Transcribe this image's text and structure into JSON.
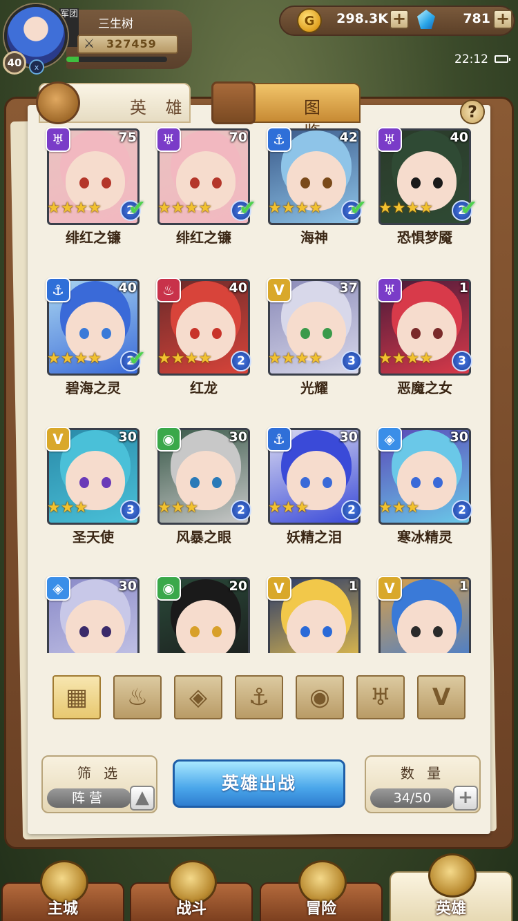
{
  "player": {
    "name": "三生树",
    "level": "40",
    "guild_badge": "军团",
    "vip_badge": "x",
    "power": "327459",
    "exp_progress": 0.12
  },
  "currency": {
    "gold": "298.3K",
    "diamonds": "781"
  },
  "status_bar": {
    "time": "22:12"
  },
  "tabs": {
    "heroes": "英 雄",
    "codex": "图 鉴"
  },
  "help_label": "?",
  "factions": {
    "dark": {
      "color": "#7a3cc8",
      "glyph": "♅"
    },
    "sea": {
      "color": "#2f6fd8",
      "glyph": "⚓"
    },
    "fire": {
      "color": "#c8324a",
      "glyph": "♨"
    },
    "light": {
      "color": "#d9a82a",
      "glyph": "V"
    },
    "beast": {
      "color": "#3aa84a",
      "glyph": "◉"
    },
    "ice": {
      "color": "#3a8ee8",
      "glyph": "◈"
    }
  },
  "heroes": [
    {
      "name": "绯红之镰",
      "level": "75",
      "faction": "dark",
      "stars": 4,
      "rank": "2",
      "deployed": true,
      "hair": "#f2b8c0",
      "eye": "#b4362a",
      "bg": "#e9c2c0"
    },
    {
      "name": "绯红之镰",
      "level": "70",
      "faction": "dark",
      "stars": 4,
      "rank": "2",
      "deployed": true,
      "hair": "#f2b8c0",
      "eye": "#b4362a",
      "bg": "#e9c2c0"
    },
    {
      "name": "海神",
      "level": "42",
      "faction": "sea",
      "stars": 4,
      "rank": "2",
      "deployed": true,
      "hair": "#8ec4e8",
      "eye": "#7a4a1a",
      "bg": "#3b5a8a"
    },
    {
      "name": "恐惧梦魇",
      "level": "40",
      "faction": "dark",
      "stars": 4,
      "rank": "2",
      "deployed": true,
      "hair": "#2f4a34",
      "eye": "#1a1a1a",
      "bg": "#2a3a2a"
    },
    {
      "name": "碧海之灵",
      "level": "40",
      "faction": "sea",
      "stars": 4,
      "rank": "2",
      "deployed": true,
      "hair": "#3a6ad8",
      "eye": "#3a7ad8",
      "bg": "#a8d4f0"
    },
    {
      "name": "红龙",
      "level": "40",
      "faction": "fire",
      "stars": 4,
      "rank": "2",
      "deployed": false,
      "hair": "#d8443a",
      "eye": "#c8342a",
      "bg": "#6a2a2a"
    },
    {
      "name": "光耀",
      "level": "37",
      "faction": "light",
      "stars": 4,
      "rank": "3",
      "deployed": false,
      "hair": "#d8d8ea",
      "eye": "#3a9a4a",
      "bg": "#8a8ab8"
    },
    {
      "name": "恶魔之女",
      "level": "1",
      "faction": "dark",
      "stars": 4,
      "rank": "3",
      "deployed": false,
      "hair": "#d83a4a",
      "eye": "#7a2a2a",
      "bg": "#4a1a3a"
    },
    {
      "name": "圣天使",
      "level": "30",
      "faction": "light",
      "stars": 3,
      "rank": "3",
      "deployed": false,
      "hair": "#4ac0d8",
      "eye": "#6a3ab8",
      "bg": "#2a8aa8"
    },
    {
      "name": "风暴之眼",
      "level": "30",
      "faction": "beast",
      "stars": 3,
      "rank": "2",
      "deployed": false,
      "hair": "#c8c8c8",
      "eye": "#2a7ab8",
      "bg": "#3a5a4a"
    },
    {
      "name": "妖精之泪",
      "level": "30",
      "faction": "sea",
      "stars": 3,
      "rank": "2",
      "deployed": false,
      "hair": "#3a4ad8",
      "eye": "#3a6ad8",
      "bg": "#d8d8f0"
    },
    {
      "name": "寒冰精灵",
      "level": "30",
      "faction": "ice",
      "stars": 3,
      "rank": "2",
      "deployed": false,
      "hair": "#6ac8e8",
      "eye": "#3a6ad8",
      "bg": "#5a4ab8"
    },
    {
      "name": "",
      "level": "30",
      "faction": "ice",
      "stars": 0,
      "rank": "",
      "deployed": false,
      "hair": "#c8c8e8",
      "eye": "#3a2a6a",
      "bg": "#8a8ac8"
    },
    {
      "name": "",
      "level": "20",
      "faction": "beast",
      "stars": 0,
      "rank": "",
      "deployed": false,
      "hair": "#1a1a1a",
      "eye": "#d8a02a",
      "bg": "#2a4a3a"
    },
    {
      "name": "",
      "level": "1",
      "faction": "light",
      "stars": 0,
      "rank": "",
      "deployed": false,
      "hair": "#f2c84a",
      "eye": "#2a6ad8",
      "bg": "#2a3a6a"
    },
    {
      "name": "",
      "level": "1",
      "faction": "light",
      "stars": 0,
      "rank": "",
      "deployed": false,
      "hair": "#3a7ad8",
      "eye": "#2a2a2a",
      "bg": "#d8a04a"
    }
  ],
  "faction_filters": [
    {
      "id": "all",
      "glyph": "▦",
      "active": true
    },
    {
      "id": "fire",
      "glyph": "♨",
      "active": false
    },
    {
      "id": "ice",
      "glyph": "◈",
      "active": false
    },
    {
      "id": "sea",
      "glyph": "⚓",
      "active": false
    },
    {
      "id": "beast",
      "glyph": "◉",
      "active": false
    },
    {
      "id": "dark",
      "glyph": "♅",
      "active": false
    },
    {
      "id": "light",
      "glyph": "V",
      "active": false
    }
  ],
  "filter": {
    "title": "筛 选",
    "value": "阵营",
    "toggle_icon": "▲"
  },
  "deploy_button": "英雄出战",
  "count": {
    "title": "数 量",
    "value": "34/50",
    "plus": "+"
  },
  "nav": [
    {
      "label": "主城",
      "active": false
    },
    {
      "label": "战斗",
      "active": false
    },
    {
      "label": "冒险",
      "active": false
    },
    {
      "label": "英雄",
      "active": true
    }
  ]
}
